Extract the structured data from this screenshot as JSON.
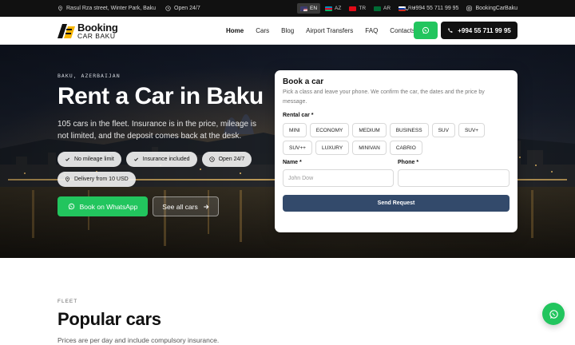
{
  "topbar": {
    "address": "Rasul Rza street, Winter Park, Baku",
    "hours": "Open 24/7",
    "languages": [
      {
        "code": "EN",
        "flag": "us-flag-icon",
        "active": true
      },
      {
        "code": "AZ",
        "flag": "az-flag-icon",
        "active": false
      },
      {
        "code": "TR",
        "flag": "tr-flag-icon",
        "active": false
      },
      {
        "code": "AR",
        "flag": "ar-flag-icon",
        "active": false
      },
      {
        "code": "RU",
        "flag": "ru-flag-icon",
        "active": false
      }
    ],
    "phone": "+994 55 711 99 95",
    "instagram": "BookingCarBaku"
  },
  "header": {
    "logo_line1": "Booking",
    "logo_line2": "CAR BAKU",
    "nav": [
      "Home",
      "Cars",
      "Blog",
      "Airport Transfers",
      "FAQ",
      "Contacts"
    ],
    "call_label": "+994 55 711 99 95"
  },
  "hero": {
    "kicker": "BAKU, AZERBAIJAN",
    "title": "Rent a Car in Baku",
    "description": "105 cars in the fleet. Insurance is in the price, mileage is not limited, and the deposit comes back at the desk.",
    "pills": [
      {
        "label": "No mileage limit",
        "icon": "check-icon"
      },
      {
        "label": "Insurance included",
        "icon": "check-icon"
      },
      {
        "label": "Open 24/7",
        "icon": "clock-icon"
      },
      {
        "label": "Delivery from 10 USD",
        "icon": "pin-icon"
      }
    ],
    "whatsapp_button": "Book on WhatsApp",
    "cars_button": "See all cars"
  },
  "booking": {
    "title": "Book a car",
    "subtitle": "Pick a class and leave your phone. We confirm the car, the dates and the price by message.",
    "class_label": "Rental car *",
    "classes": [
      "MINI",
      "ECONOMY",
      "MEDIUM",
      "BUSINESS",
      "SUV",
      "SUV+",
      "SUV++",
      "LUXURY",
      "MINIVAN",
      "CABRIO"
    ],
    "name_label": "Name *",
    "name_placeholder": "John Dow",
    "phone_label": "Phone *",
    "phone_placeholder": "",
    "submit": "Send Request"
  },
  "fleet": {
    "kicker": "FLEET",
    "title": "Popular cars",
    "description": "Prices are per day and include compulsory insurance."
  },
  "colors": {
    "whatsapp_green": "#22c55e",
    "submit_blue": "#334a6b",
    "dark": "#111111"
  }
}
